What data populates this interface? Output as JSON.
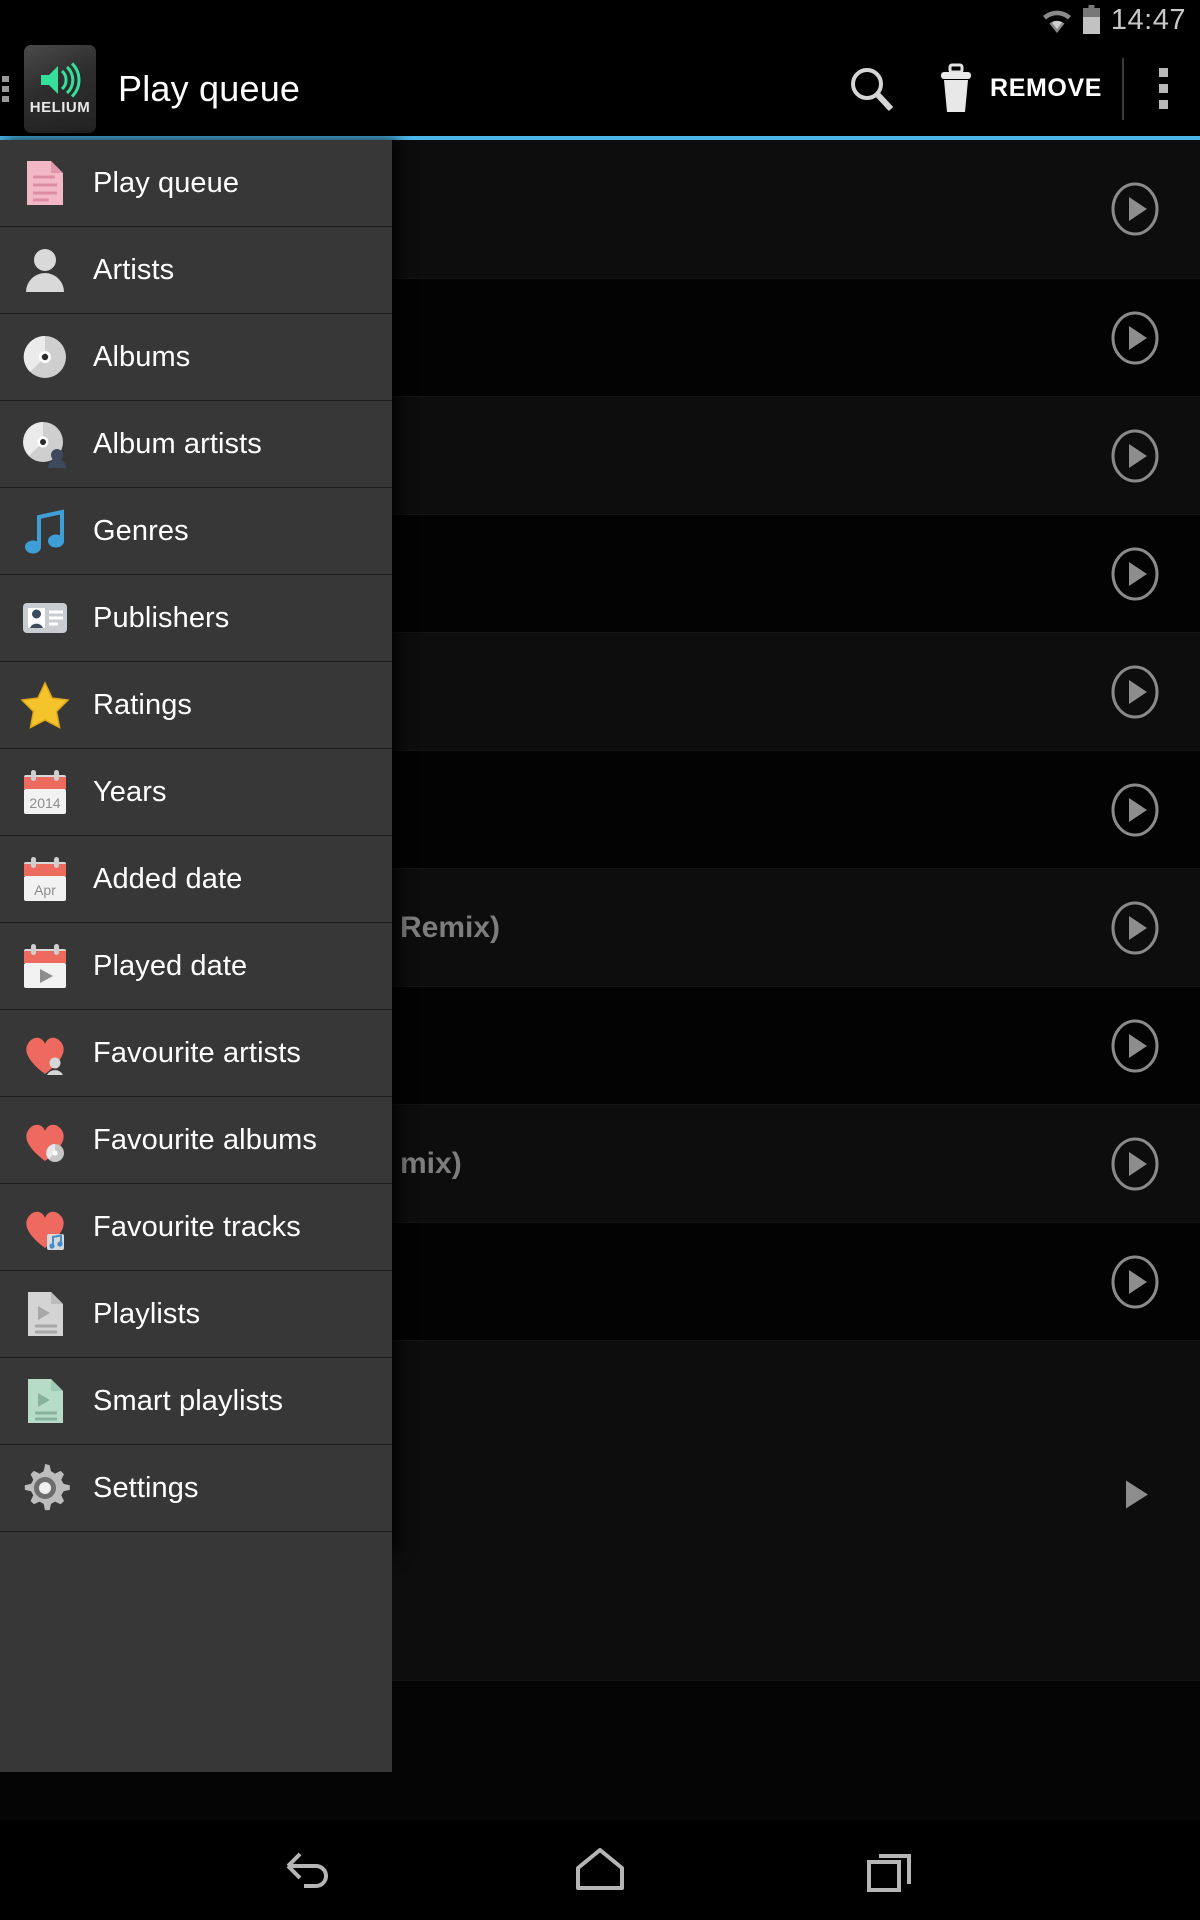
{
  "status_bar": {
    "time": "14:47",
    "icons": [
      "wifi-icon",
      "battery-icon"
    ]
  },
  "action_bar": {
    "app_icon_label": "HELIUM",
    "title": "Play queue",
    "search_label": "Search",
    "remove_label": "REMOVE",
    "overflow_label": "More options",
    "accent_color": "#4bb6e8"
  },
  "drawer": {
    "items": [
      {
        "label": "Play queue",
        "icon": "pink-document-icon",
        "selected": true
      },
      {
        "label": "Artists",
        "icon": "person-icon",
        "selected": false
      },
      {
        "label": "Albums",
        "icon": "disc-icon",
        "selected": false
      },
      {
        "label": "Album artists",
        "icon": "disc-person-icon",
        "selected": false
      },
      {
        "label": "Genres",
        "icon": "music-note-icon",
        "selected": false
      },
      {
        "label": "Publishers",
        "icon": "id-card-icon",
        "selected": false
      },
      {
        "label": "Ratings",
        "icon": "star-icon",
        "selected": false
      },
      {
        "label": "Years",
        "icon": "calendar-year-icon",
        "selected": false
      },
      {
        "label": "Added date",
        "icon": "calendar-month-icon",
        "selected": false
      },
      {
        "label": "Played date",
        "icon": "calendar-play-icon",
        "selected": false
      },
      {
        "label": "Favourite artists",
        "icon": "heart-person-icon",
        "selected": false
      },
      {
        "label": "Favourite albums",
        "icon": "heart-disc-icon",
        "selected": false
      },
      {
        "label": "Favourite tracks",
        "icon": "heart-track-icon",
        "selected": false
      },
      {
        "label": "Playlists",
        "icon": "playlist-icon",
        "selected": false
      },
      {
        "label": "Smart playlists",
        "icon": "smart-playlist-icon",
        "selected": false
      },
      {
        "label": "Settings",
        "icon": "gear-icon",
        "selected": false
      }
    ],
    "calendar_year_text": "2014",
    "calendar_month_text": "Apr"
  },
  "track_list": {
    "rows": [
      {
        "text": ""
      },
      {
        "text": ""
      },
      {
        "text": ""
      },
      {
        "text": ""
      },
      {
        "text": ""
      },
      {
        "text": ""
      },
      {
        "text": "Remix)"
      },
      {
        "text": ""
      },
      {
        "text": "mix)"
      },
      {
        "text": ""
      },
      {
        "text": ""
      }
    ],
    "play_icon": "play-circle-icon"
  },
  "nav_bar": {
    "back_label": "Back",
    "home_label": "Home",
    "recents_label": "Recent apps"
  }
}
